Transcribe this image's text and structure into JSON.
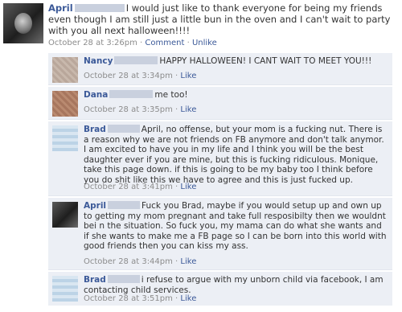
{
  "post": {
    "author": "April",
    "text": "I would just like to thank everyone for being my friends even though I am still just a little bun in the oven and I can't wait to party with you all next halloween!!!!",
    "time": "October 28 at 3:26pm",
    "sep": " · ",
    "comment_link": "Comment",
    "unlike_link": "Unlike"
  },
  "comments": [
    {
      "author": "Nancy",
      "text": "HAPPY HALLOWEEN! I CANT WAIT TO MEET YOU!!!",
      "time": "October 28 at 3:34pm",
      "like": "Like"
    },
    {
      "author": "Dana",
      "text": "me too!",
      "time": "October 28 at 3:35pm",
      "like": "Like"
    },
    {
      "author": "Brad",
      "text": "April, no offense, but your mom is a fucking nut. There is a reason why we are not friends on FB anymore and don't talk anymor. I am excited to have you in my life and I think you will be the best daughter ever if you are mine, but this is fucking ridiculous. Monique, take this page down. if this is going to be my baby too I think before you do shit like this we have to agree and this is just fucked up.",
      "time": "October 28 at 3:41pm",
      "like": "Like"
    },
    {
      "author": "April",
      "text": "Fuck you Brad, maybe if you would setup up and own up to getting my mom pregnant and take full resposibilty then we wouldnt bei n the situation. So fuck you, my mama can do what she wants and if she wants to make me a FB page so I can be born into this world with good friends then you can kiss my ass.",
      "time": "October 28 at 3:44pm",
      "like": "Like"
    },
    {
      "author": "Brad",
      "text": "i refuse to argue with my unborn child via facebook, I am contacting child services.",
      "time": "October 28 at 3:51pm",
      "like": "Like"
    }
  ]
}
